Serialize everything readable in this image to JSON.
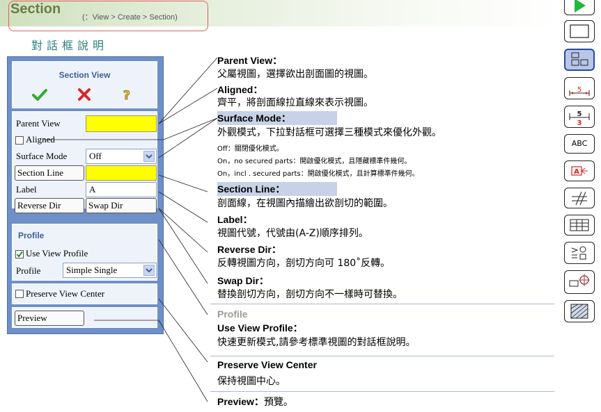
{
  "header": {
    "title": "Section",
    "path": "(：View > Create > Section)"
  },
  "subtitle": "對話框說明",
  "dialog": {
    "title": "Section View",
    "parent_view_label": "Parent View",
    "aligned_label": "Aligned",
    "surface_mode_label": "Surface Mode",
    "surface_mode_value": "Off",
    "section_line_button": "Section Line",
    "label_label": "Label",
    "label_value": "A",
    "reverse_dir_button": "Reverse Dir",
    "swap_dir_button": "Swap Dir",
    "profile_title": "Profile",
    "use_view_profile_label": "Use View Profile",
    "profile_label": "Profile",
    "profile_value": "Simple Single",
    "preserve_view_center_label": "Preserve View Center",
    "preview_button": "Preview"
  },
  "desc": {
    "parent_view_title": "Parent View：",
    "parent_view_text": "父屬視圖，選擇欲出剖面圖的視圖。",
    "aligned_title": "Aligned：",
    "aligned_text": "齊平，將剖面線拉直線來表示視圖。",
    "surface_mode_title": "Surface Mode：",
    "surface_mode_text": "外觀模式，下拉對話框可選擇三種模式來優化外觀。",
    "opt1": "Off：關閉優化模式。",
    "opt2": "On，no secured parts：開啟優化模式，且隱藏標準件幾何。",
    "opt3": "On，incl . secured parts：開啟優化模式，且計算標準件幾何。",
    "section_line_title": "Section Line：",
    "section_line_text": "剖面線，在視圖內描繪出欲剖切的範圍。",
    "label_title": "Label：",
    "label_text": "視圖代號，代號由(A-Z)順序排列。",
    "reverse_dir_title": "Reverse Dir：",
    "reverse_dir_text": "反轉視圖方向，剖切方向可 180˚反轉。",
    "swap_dir_title": "Swap Dir：",
    "swap_dir_text": "替換剖切方向，剖切方向不一樣時可替換。",
    "profile_title": "Profile",
    "use_view_profile_title": "Use View Profile：",
    "use_view_profile_text": "快速更新模式,請參考標準視圖的對話框說明。",
    "preserve_view_center_title": "Preserve View Center",
    "preserve_view_center_text": "保持視圖中心。",
    "preview_title": "Preview：",
    "preview_text": "預覽。"
  },
  "toolbar": {
    "abc_label": "ABC",
    "dim5_label": "5",
    "dim53_top": "5",
    "dim53_bottom": "3"
  },
  "colors": {
    "accent": "#6f8fc7",
    "highlight": "#c7d2e6",
    "field_yellow": "#ffff00"
  }
}
